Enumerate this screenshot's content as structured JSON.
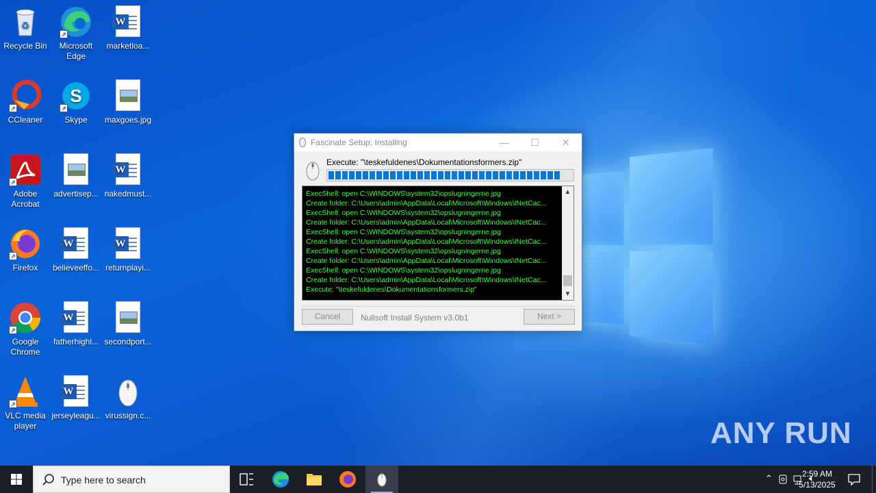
{
  "desktop": {
    "icons": [
      {
        "label": "Recycle Bin",
        "icon": "recycle-bin-icon"
      },
      {
        "label": "Microsoft Edge",
        "icon": "edge-icon"
      },
      {
        "label": "marketloa...",
        "icon": "word-document-icon"
      },
      {
        "label": "CCleaner",
        "icon": "ccleaner-icon"
      },
      {
        "label": "Skype",
        "icon": "skype-icon"
      },
      {
        "label": "maxgoes.jpg",
        "icon": "image-file-icon"
      },
      {
        "label": "Adobe Acrobat",
        "icon": "acrobat-icon"
      },
      {
        "label": "advertisep...",
        "icon": "image-file-icon"
      },
      {
        "label": "nakedmust...",
        "icon": "word-document-icon"
      },
      {
        "label": "Firefox",
        "icon": "firefox-icon"
      },
      {
        "label": "believeeffo...",
        "icon": "word-document-icon"
      },
      {
        "label": "returnplayi...",
        "icon": "word-document-icon"
      },
      {
        "label": "Google Chrome",
        "icon": "chrome-icon"
      },
      {
        "label": "fatherhighl...",
        "icon": "word-document-icon"
      },
      {
        "label": "secondport...",
        "icon": "image-file-icon"
      },
      {
        "label": "VLC media player",
        "icon": "vlc-icon"
      },
      {
        "label": "jerseyleagu...",
        "icon": "word-document-icon"
      },
      {
        "label": "virussign.c...",
        "icon": "mouse-installer-icon"
      }
    ]
  },
  "dialog": {
    "title": "Fascinate Setup: Installing",
    "execute_label": "Execute: \"\\teskefuldenes\\Dokumentationsformers.zip\"",
    "progress_fraction": 0.95,
    "log_lines": [
      "ExecShell: open C:\\WINDOWS\\system32\\opslugningerne.jpg",
      "Create folder: C:\\Users\\admin\\AppData\\Local\\Microsoft\\Windows\\INetCac...",
      "ExecShell: open C:\\WINDOWS\\system32\\opslugningerne.jpg",
      "Create folder: C:\\Users\\admin\\AppData\\Local\\Microsoft\\Windows\\INetCac...",
      "ExecShell: open C:\\WINDOWS\\system32\\opslugningerne.jpg",
      "Create folder: C:\\Users\\admin\\AppData\\Local\\Microsoft\\Windows\\INetCac...",
      "ExecShell: open C:\\WINDOWS\\system32\\opslugningerne.jpg",
      "Create folder: C:\\Users\\admin\\AppData\\Local\\Microsoft\\Windows\\INetCac...",
      "ExecShell: open C:\\WINDOWS\\system32\\opslugningerne.jpg",
      "Create folder: C:\\Users\\admin\\AppData\\Local\\Microsoft\\Windows\\INetCac...",
      "Execute: \"\\teskefuldenes\\Dokumentationsformers.zip\""
    ],
    "cancel_label": "Cancel",
    "brand": "Nullsoft Install System v3.0b1",
    "next_label": "Next >"
  },
  "taskbar": {
    "search_placeholder": "Type here to search",
    "time": "2:59 AM",
    "date": "5/13/2025"
  },
  "watermark": "ANY RUN",
  "colors": {
    "accent": "#0678d4",
    "log_text": "#3cff3c",
    "taskbar": "#1c1f2a"
  }
}
